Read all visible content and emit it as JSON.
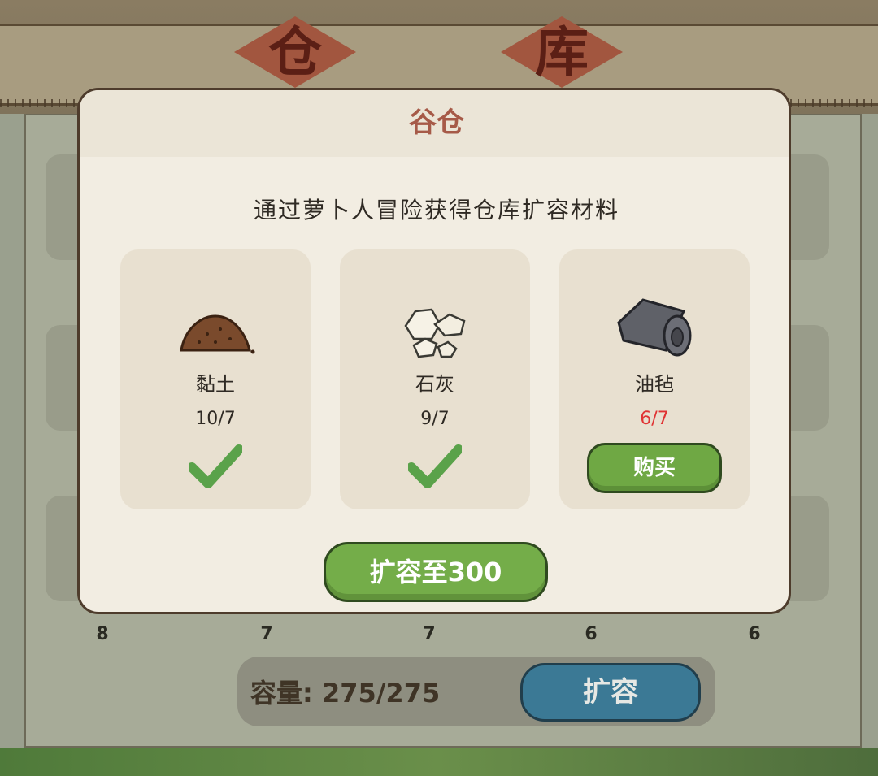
{
  "background": {
    "title_chars": [
      "仓",
      "库"
    ],
    "slot_counts": [
      "8",
      "7",
      "7",
      "6",
      "6"
    ],
    "capacity_text": "容量: 275/275",
    "expand_label": "扩容"
  },
  "modal": {
    "title": "谷仓",
    "description": "通过萝卜人冒险获得仓库扩容材料",
    "materials": [
      {
        "name": "黏土",
        "count": "10/7",
        "sufficient": true,
        "icon": "clay-pile-icon"
      },
      {
        "name": "石灰",
        "count": "9/7",
        "sufficient": true,
        "icon": "lime-rocks-icon"
      },
      {
        "name": "油毡",
        "count": "6/7",
        "sufficient": false,
        "icon": "felt-roll-icon",
        "buy_label": "购买"
      }
    ],
    "upgrade_label": "扩容至300"
  },
  "colors": {
    "sufficient_check": "#5aa24a",
    "insufficient_count": "#e03434",
    "green_button": "#74ad49",
    "blue_button": "#3b7995",
    "title_red": "#a65a48"
  }
}
